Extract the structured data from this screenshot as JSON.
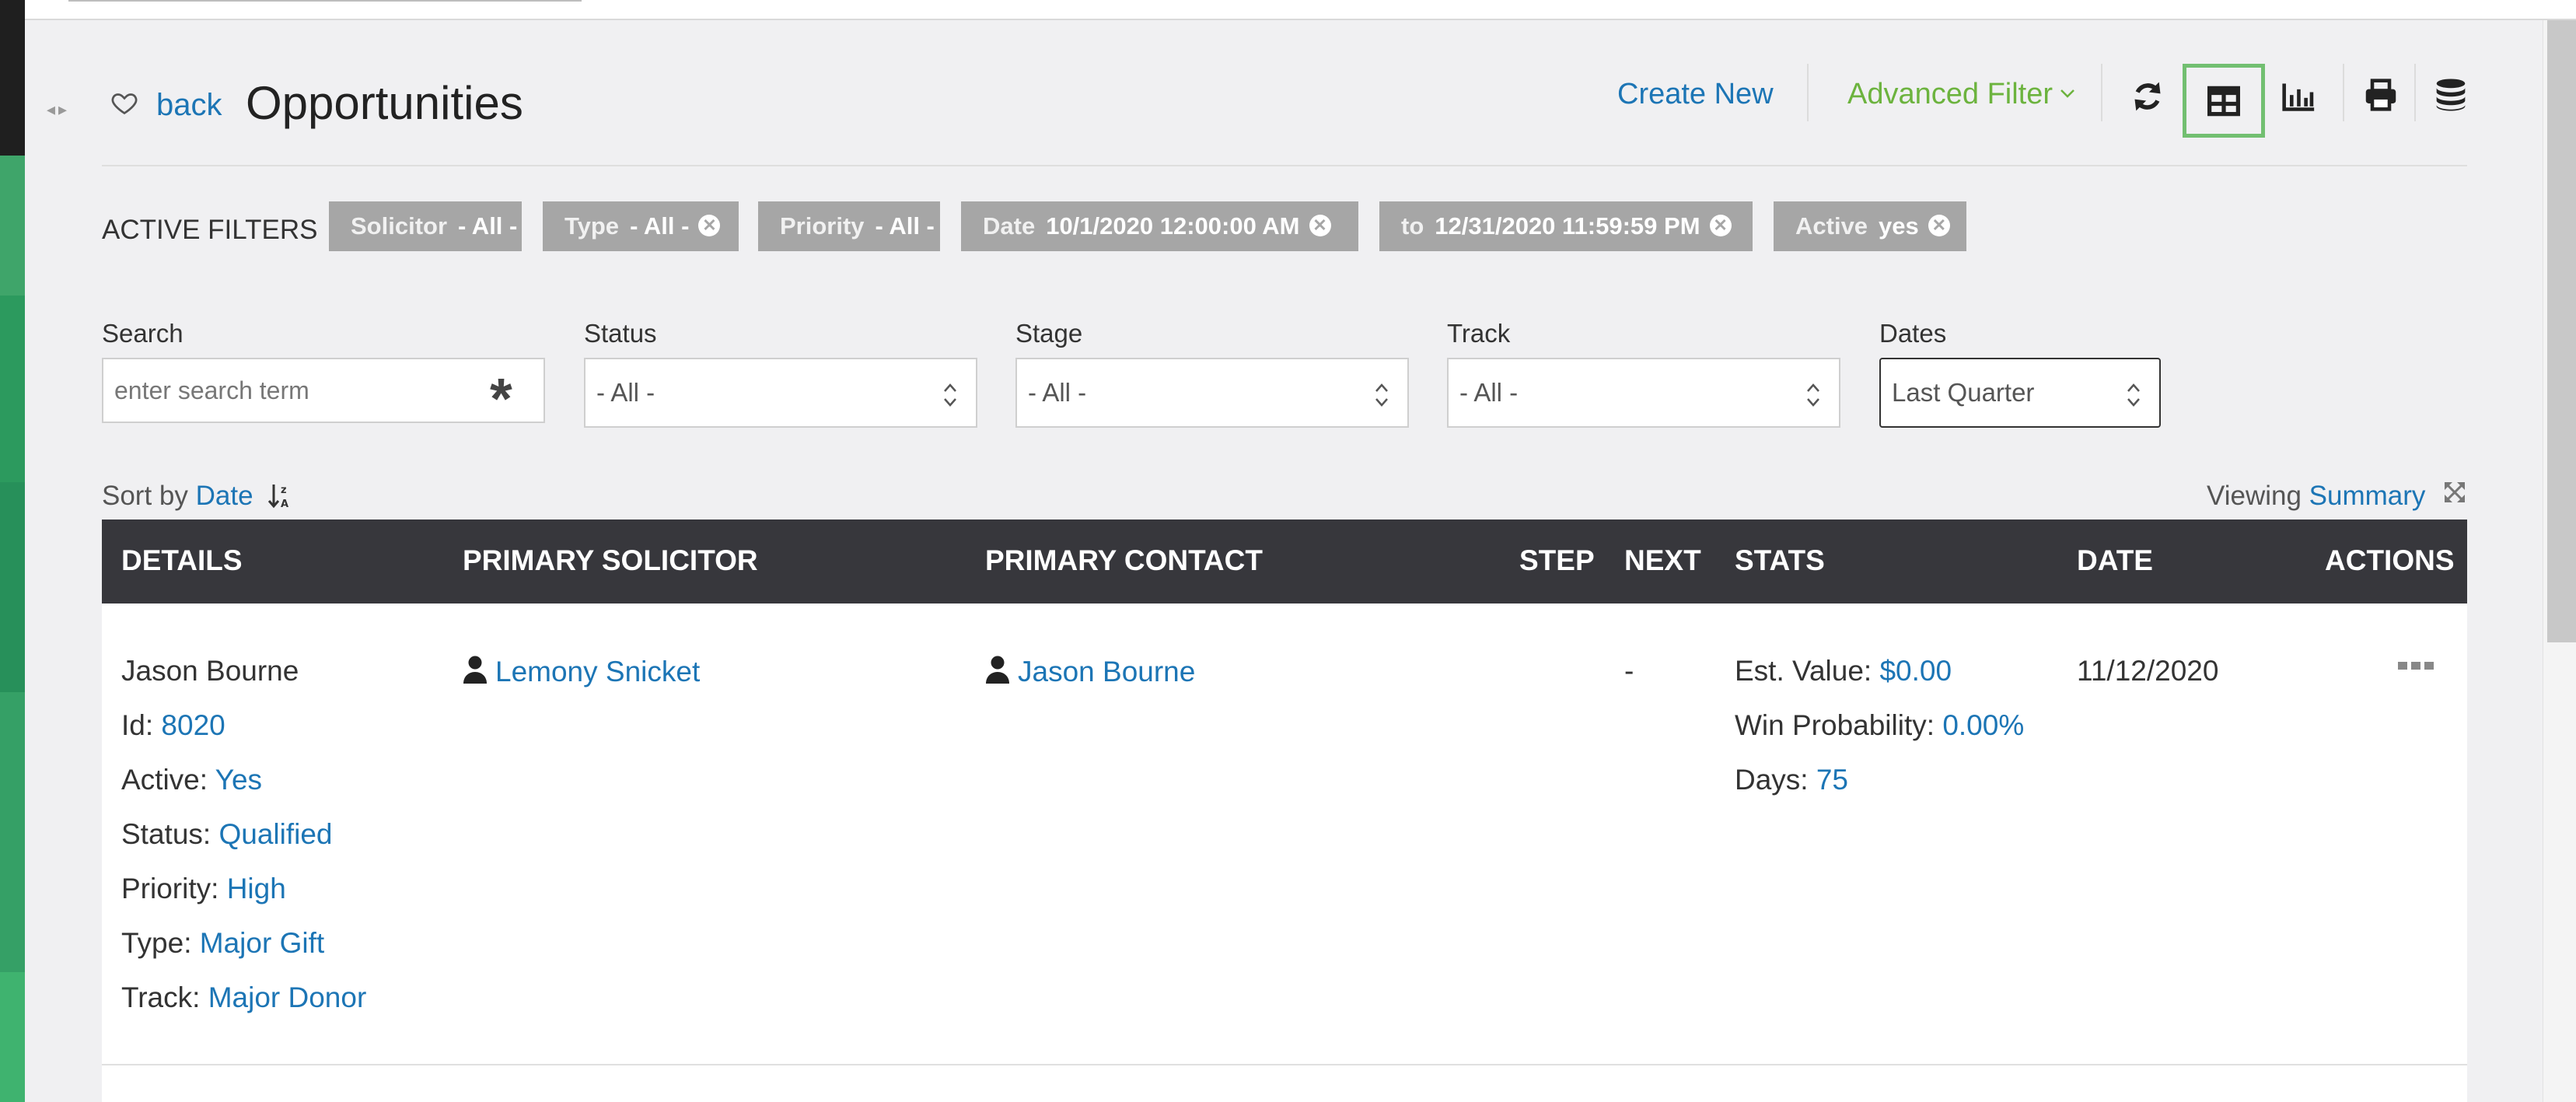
{
  "nav": {
    "back_label": "back"
  },
  "page": {
    "title": "Opportunities"
  },
  "toolbar": {
    "create_new": "Create New",
    "advanced_filter": "Advanced Filter",
    "icons": [
      "refresh-icon",
      "table-view-icon",
      "chart-icon",
      "print-icon",
      "database-icon"
    ]
  },
  "active_filters": {
    "label": "ACTIVE FILTERS",
    "chips": [
      {
        "label": "Solicitor",
        "value": "- All -",
        "removable": false
      },
      {
        "label": "Type",
        "value": "- All -",
        "removable": true
      },
      {
        "label": "Priority",
        "value": "- All -",
        "removable": false
      },
      {
        "label": "Date",
        "value": "10/1/2020 12:00:00 AM",
        "removable": true
      },
      {
        "label": "to",
        "value": "12/31/2020 11:59:59 PM",
        "removable": true
      },
      {
        "label": "Active",
        "value": "yes",
        "removable": true
      }
    ]
  },
  "filters": {
    "search": {
      "label": "Search",
      "placeholder": "enter search term"
    },
    "status": {
      "label": "Status",
      "value": "- All -"
    },
    "stage": {
      "label": "Stage",
      "value": "- All -"
    },
    "track": {
      "label": "Track",
      "value": "- All -"
    },
    "dates": {
      "label": "Dates",
      "value": "Last Quarter"
    }
  },
  "sort": {
    "prefix": "Sort by",
    "field": "Date"
  },
  "viewing": {
    "prefix": "Viewing",
    "mode": "Summary"
  },
  "table": {
    "columns": [
      "DETAILS",
      "PRIMARY SOLICITOR",
      "PRIMARY CONTACT",
      "STEP",
      "NEXT",
      "STATS",
      "DATE",
      "ACTIONS"
    ],
    "rows": [
      {
        "name": "Jason Bourne",
        "details": [
          {
            "label": "Id:",
            "value": "8020"
          },
          {
            "label": "Active:",
            "value": "Yes"
          },
          {
            "label": "Status:",
            "value": "Qualified"
          },
          {
            "label": "Priority:",
            "value": "High"
          },
          {
            "label": "Type:",
            "value": "Major Gift"
          },
          {
            "label": "Track:",
            "value": "Major Donor"
          }
        ],
        "solicitor": "Lemony Snicket",
        "contact": "Jason Bourne",
        "step": "",
        "next": "-",
        "stats": [
          {
            "label": "Est. Value:",
            "value": "$0.00"
          },
          {
            "label": "Win Probability:",
            "value": "0.00%"
          },
          {
            "label": "Days:",
            "value": "75"
          }
        ],
        "date": "11/12/2020"
      }
    ]
  },
  "colors": {
    "link": "#1c75b5",
    "accent_green": "#6cb33e",
    "header_bg": "#37373c",
    "chip_bg": "#a6a6a6",
    "selected_outline": "#72bf71"
  }
}
